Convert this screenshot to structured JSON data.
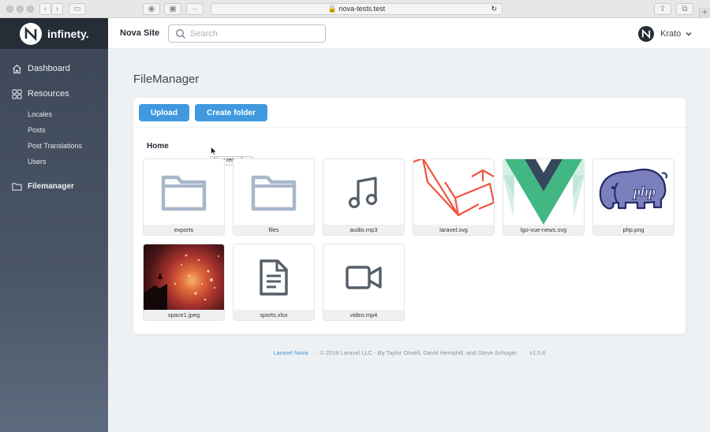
{
  "browser": {
    "url": "nova-tests.test"
  },
  "sidebar": {
    "brand": "infinety.",
    "dashboard": "Dashboard",
    "resources": "Resources",
    "items": [
      "Locales",
      "Posts",
      "Post Translations",
      "Users"
    ],
    "filemanager": "Filemanager"
  },
  "header": {
    "site_name": "Nova Site",
    "search_placeholder": "Search",
    "user_name": "Krato"
  },
  "main": {
    "title": "FileManager",
    "upload_label": "Upload",
    "create_folder_label": "Create folder",
    "breadcrumb": "Home",
    "tooltip": "New recording",
    "files": [
      {
        "name": "exports",
        "kind": "folder"
      },
      {
        "name": "files",
        "kind": "folder"
      },
      {
        "name": "audio.mp3",
        "kind": "audio"
      },
      {
        "name": "laravel.svg",
        "kind": "image-laravel"
      },
      {
        "name": "lgo-vue-news.svg",
        "kind": "image-vue"
      },
      {
        "name": "php.png",
        "kind": "image-php"
      },
      {
        "name": "space1.jpeg",
        "kind": "image-space"
      },
      {
        "name": "sports.xlsx",
        "kind": "document"
      },
      {
        "name": "video.mp4",
        "kind": "video"
      }
    ]
  },
  "footer": {
    "link": "Laravel Nova",
    "sep": "·",
    "copyright": "© 2018 Laravel LLC - By Taylor Otwell, David Hemphill, and Steve Schoger.",
    "version": "v1.0.6"
  },
  "colors": {
    "accent": "#4099de",
    "sidebar": "#3c4655",
    "brand_bg": "#252d37",
    "icon": "#a8b7c9"
  }
}
